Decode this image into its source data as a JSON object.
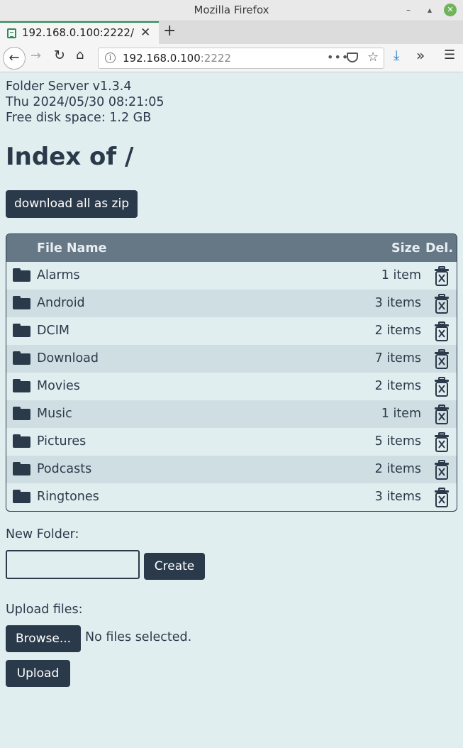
{
  "window": {
    "title": "Mozilla Firefox",
    "min_glyph": "–",
    "max_glyph": "▴",
    "close_glyph": "✕"
  },
  "tab": {
    "title": "192.168.0.100:2222/",
    "close_glyph": "✕",
    "new_tab_glyph": "+"
  },
  "nav": {
    "back_glyph": "←",
    "forward_glyph": "→",
    "reload_glyph": "↻",
    "home_glyph": "⌂",
    "url_host": "192.168.0.100",
    "url_port": ":2222",
    "info_glyph": "i",
    "more_glyph": "•••",
    "star_glyph": "☆",
    "download_glyph": "⤓",
    "overflow_glyph": "»",
    "menu_glyph": "☰"
  },
  "server": {
    "version": "Folder Server v1.3.4",
    "datetime": "Thu 2024/05/30 08:21:05",
    "disk": "Free disk space: 1.2 GB"
  },
  "heading": "Index of /",
  "buttons": {
    "zip": "download all as zip",
    "create": "Create",
    "browse": "Browse...",
    "upload": "Upload"
  },
  "table": {
    "headers": {
      "name": "File Name",
      "size": "Size",
      "del": "Del."
    },
    "rows": [
      {
        "name": "Alarms",
        "size": "1 item"
      },
      {
        "name": "Android",
        "size": "3 items"
      },
      {
        "name": "DCIM",
        "size": "2 items"
      },
      {
        "name": "Download",
        "size": "7 items"
      },
      {
        "name": "Movies",
        "size": "2 items"
      },
      {
        "name": "Music",
        "size": "1 item"
      },
      {
        "name": "Pictures",
        "size": "5 items"
      },
      {
        "name": "Podcasts",
        "size": "2 items"
      },
      {
        "name": "Ringtones",
        "size": "3 items"
      }
    ]
  },
  "new_folder": {
    "label": "New Folder:",
    "value": ""
  },
  "upload": {
    "label": "Upload files:",
    "status": "No files selected."
  },
  "icons": {
    "row_icon": "folder-icon",
    "delete_icon": "trash-icon"
  },
  "colors": {
    "background": "#e0eef0",
    "primary": "#2b3a4a",
    "table_header": "#667785",
    "row_alt": "#cfdee2"
  }
}
